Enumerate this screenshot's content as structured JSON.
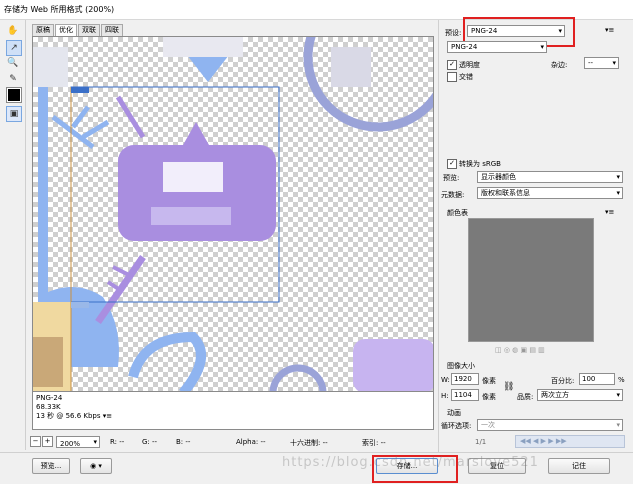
{
  "window": {
    "title": "存储为 Web 所用格式 (200%)"
  },
  "tools": [
    "hand-tool",
    "slice-select-tool",
    "zoom-tool",
    "eyedropper-tool"
  ],
  "tabs": [
    "原稿",
    "优化",
    "双联",
    "四联"
  ],
  "active_tab": 1,
  "info": {
    "format": "PNG-24",
    "size": "68.33K",
    "time": "13 秒 @ 56.6 Kbps"
  },
  "status": {
    "zoom": "200%",
    "r": "R: --",
    "g": "G: --",
    "b": "B: --",
    "alpha": "Alpha: --",
    "hex": "十六进制: --",
    "index": "索引: --"
  },
  "preset": {
    "label": "预设:",
    "value": "PNG-24"
  },
  "format_select": "PNG-24",
  "options": {
    "transparency": "透明度",
    "matte_label": "杂边:",
    "matte_value": "--",
    "interlaced": "交错"
  },
  "convert": {
    "label": "转换为 sRGB",
    "preview_label": "预览:",
    "preview_value": "显示器颜色",
    "metadata_label": "元数据:",
    "metadata_value": "版权和联系信息"
  },
  "color_table": {
    "label": "颜色表"
  },
  "image_size": {
    "label": "图像大小",
    "w_label": "W:",
    "w_value": "1920",
    "h_label": "H:",
    "h_value": "1104",
    "unit": "像素",
    "percent_label": "百分比:",
    "percent_value": "100",
    "percent_unit": "%",
    "quality_label": "品质:",
    "quality_value": "两次立方"
  },
  "animation": {
    "label": "动画",
    "loop_label": "循环选项:",
    "loop_value": "一次",
    "frame": "1/1"
  },
  "bottom": {
    "preview": "预览...",
    "save": "存储...",
    "reset": "复位",
    "remember": "记住"
  },
  "watermark": "https://blog.csdn.net/marslove521",
  "colors": {
    "accent_red": "#e02020",
    "purple": "#a98ee0",
    "blue": "#8fb4f0"
  }
}
